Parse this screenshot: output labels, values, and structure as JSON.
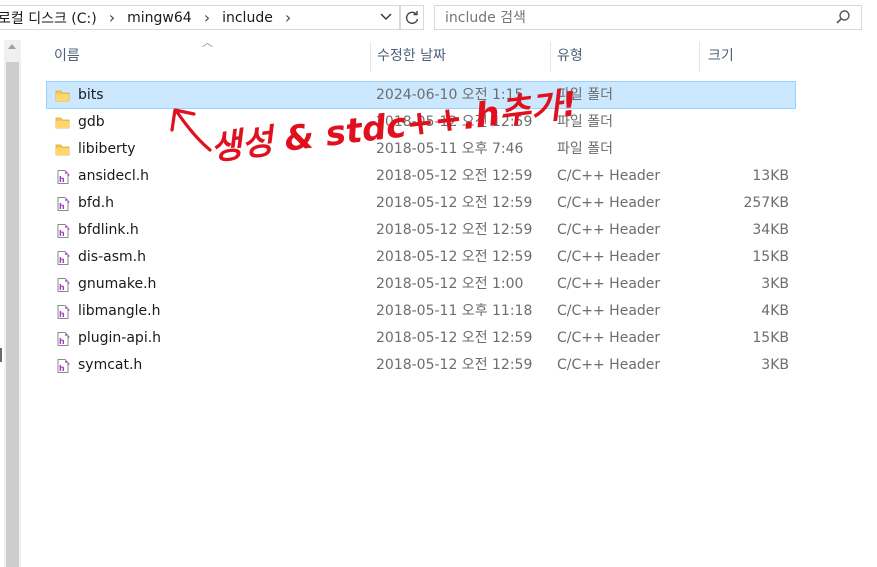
{
  "address_bar": {
    "crumbs": [
      "로컬 디스크 (C:)",
      "mingw64",
      "include"
    ]
  },
  "search": {
    "placeholder": "include 검색"
  },
  "columns": {
    "name": "이름",
    "date": "수정한 날짜",
    "type": "유형",
    "size": "크기"
  },
  "files": [
    {
      "name": "bits",
      "date": "2024-06-10 오전 1:15",
      "type": "파일 폴더",
      "size": "",
      "kind": "folder",
      "selected": true
    },
    {
      "name": "gdb",
      "date": "2018-05-12 오전 12:59",
      "type": "파일 폴더",
      "size": "",
      "kind": "folder"
    },
    {
      "name": "libiberty",
      "date": "2018-05-11 오후 7:46",
      "type": "파일 폴더",
      "size": "",
      "kind": "folder"
    },
    {
      "name": "ansidecl.h",
      "date": "2018-05-12 오전 12:59",
      "type": "C/C++ Header",
      "size": "13KB",
      "kind": "header"
    },
    {
      "name": "bfd.h",
      "date": "2018-05-12 오전 12:59",
      "type": "C/C++ Header",
      "size": "257KB",
      "kind": "header"
    },
    {
      "name": "bfdlink.h",
      "date": "2018-05-12 오전 12:59",
      "type": "C/C++ Header",
      "size": "34KB",
      "kind": "header"
    },
    {
      "name": "dis-asm.h",
      "date": "2018-05-12 오전 12:59",
      "type": "C/C++ Header",
      "size": "15KB",
      "kind": "header"
    },
    {
      "name": "gnumake.h",
      "date": "2018-05-12 오전 1:00",
      "type": "C/C++ Header",
      "size": "3KB",
      "kind": "header"
    },
    {
      "name": "libmangle.h",
      "date": "2018-05-11 오후 11:18",
      "type": "C/C++ Header",
      "size": "4KB",
      "kind": "header"
    },
    {
      "name": "plugin-api.h",
      "date": "2018-05-12 오전 12:59",
      "type": "C/C++ Header",
      "size": "15KB",
      "kind": "header"
    },
    {
      "name": "symcat.h",
      "date": "2018-05-12 오전 12:59",
      "type": "C/C++ Header",
      "size": "3KB",
      "kind": "header"
    }
  ],
  "annotation": {
    "text": "생성 & stdc++.h추가!",
    "color": "#e0101e"
  },
  "colors": {
    "selected_row": "#cce8ff",
    "folder": "#f5c84c",
    "header_text": "#4c607a"
  }
}
